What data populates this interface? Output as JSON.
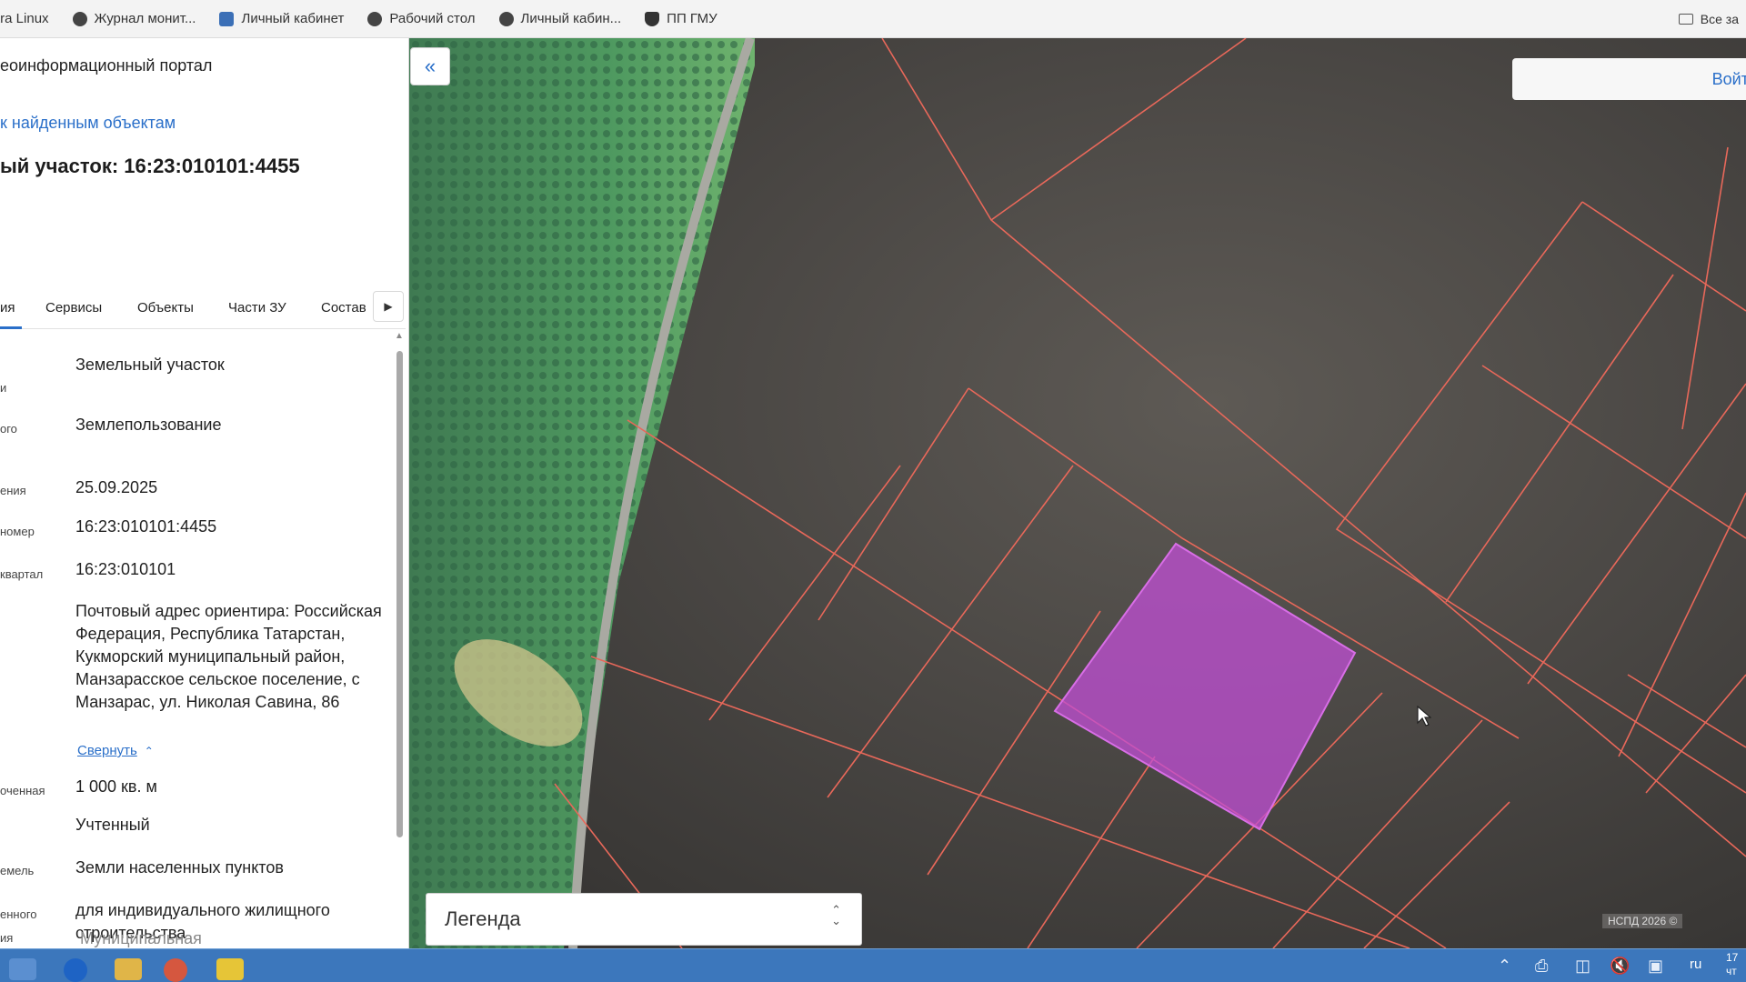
{
  "browser": {
    "bookmarks": [
      {
        "label": "tra Linux",
        "icon": "none"
      },
      {
        "label": "Журнал монит...",
        "icon": "globe-icon"
      },
      {
        "label": "Личный кабинет",
        "icon": "emblem-icon"
      },
      {
        "label": "Рабочий стол",
        "icon": "globe-icon"
      },
      {
        "label": "Личный кабин...",
        "icon": "globe-icon"
      },
      {
        "label": "ПП ГМУ",
        "icon": "shield-icon"
      }
    ],
    "all_bookmarks": "Все за"
  },
  "panel": {
    "portal_title": "еоинформационный портал",
    "back_link": "к найденным объектам",
    "parcel_title": "ый участок: 16:23:010101:4455",
    "tabs": [
      "ия",
      "Сервисы",
      "Объекты",
      "Части ЗУ",
      "Состав"
    ],
    "active_tab": 0,
    "properties": [
      {
        "label": "и",
        "value": "Земельный участок"
      },
      {
        "label": "ого",
        "value": "Землепользование"
      },
      {
        "label": "ения",
        "value": "25.09.2025"
      },
      {
        "label": "номер",
        "value": "16:23:010101:4455"
      },
      {
        "label": "квартал",
        "value": "16:23:010101"
      },
      {
        "label": "",
        "value": "Почтовый адрес ориентира: Российская Федерация, Республика Татарстан, Кукморский муниципальный район, Манзарасское сельское поселение, с Манзарас, ул. Николая Савина, 86"
      },
      {
        "label": "",
        "value": "Свернуть"
      },
      {
        "label": "оченная",
        "value": "1 000 кв. м"
      },
      {
        "label": "",
        "value": "Учтенный"
      },
      {
        "label": "емель",
        "value": "Земли населенных пунктов"
      },
      {
        "label": "енного",
        "label2": "ия",
        "value": "для индивидуального жилищного строительства"
      },
      {
        "label": "",
        "value": "Муниципальная"
      }
    ]
  },
  "map": {
    "collapse_icon": "double-chevron-left-icon",
    "login_label": "Войти",
    "legend_label": "Легенда",
    "attribution": "НСПД 2026 ©",
    "parcel_line_color": "#e8685a",
    "selected_parcel_color": "#c24fd6"
  },
  "taskbar": {
    "lang": "ru",
    "clock_time": "17",
    "clock_day": "чт"
  }
}
